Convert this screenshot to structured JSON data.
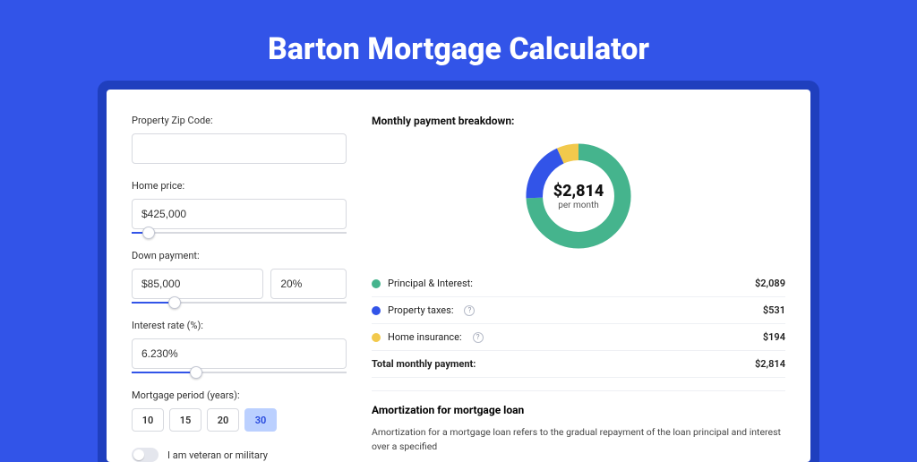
{
  "title": "Barton Mortgage Calculator",
  "form": {
    "zip": {
      "label": "Property Zip Code:",
      "value": ""
    },
    "price": {
      "label": "Home price:",
      "value": "$425,000",
      "slider_pct": 8
    },
    "down": {
      "label": "Down payment:",
      "value": "$85,000",
      "pct": "20%",
      "slider_pct": 20
    },
    "rate": {
      "label": "Interest rate (%):",
      "value": "6.230%",
      "slider_pct": 30
    },
    "period": {
      "label": "Mortgage period (years):",
      "options": [
        "10",
        "15",
        "20",
        "30"
      ],
      "selected": "30"
    },
    "veteran": {
      "label": "I am veteran or military",
      "value": false
    }
  },
  "breakdown": {
    "title": "Monthly payment breakdown:",
    "donut": {
      "value": "$2,814",
      "sub": "per month"
    },
    "items": [
      {
        "label": "Principal & Interest:",
        "value": "$2,089",
        "color": "#45b48d",
        "help": false
      },
      {
        "label": "Property taxes:",
        "value": "$531",
        "color": "#3254e8",
        "help": true
      },
      {
        "label": "Home insurance:",
        "value": "$194",
        "color": "#f2c94c",
        "help": true
      }
    ],
    "total": {
      "label": "Total monthly payment:",
      "value": "$2,814"
    }
  },
  "amort": {
    "title": "Amortization for mortgage loan",
    "text": "Amortization for a mortgage loan refers to the gradual repayment of the loan principal and interest over a specified"
  },
  "chart_data": {
    "type": "pie",
    "title": "Monthly payment breakdown",
    "categories": [
      "Principal & Interest",
      "Property taxes",
      "Home insurance"
    ],
    "values": [
      2089,
      531,
      194
    ],
    "colors": [
      "#45b48d",
      "#3254e8",
      "#f2c94c"
    ],
    "total": 2814,
    "center_label": "$2,814 per month"
  }
}
